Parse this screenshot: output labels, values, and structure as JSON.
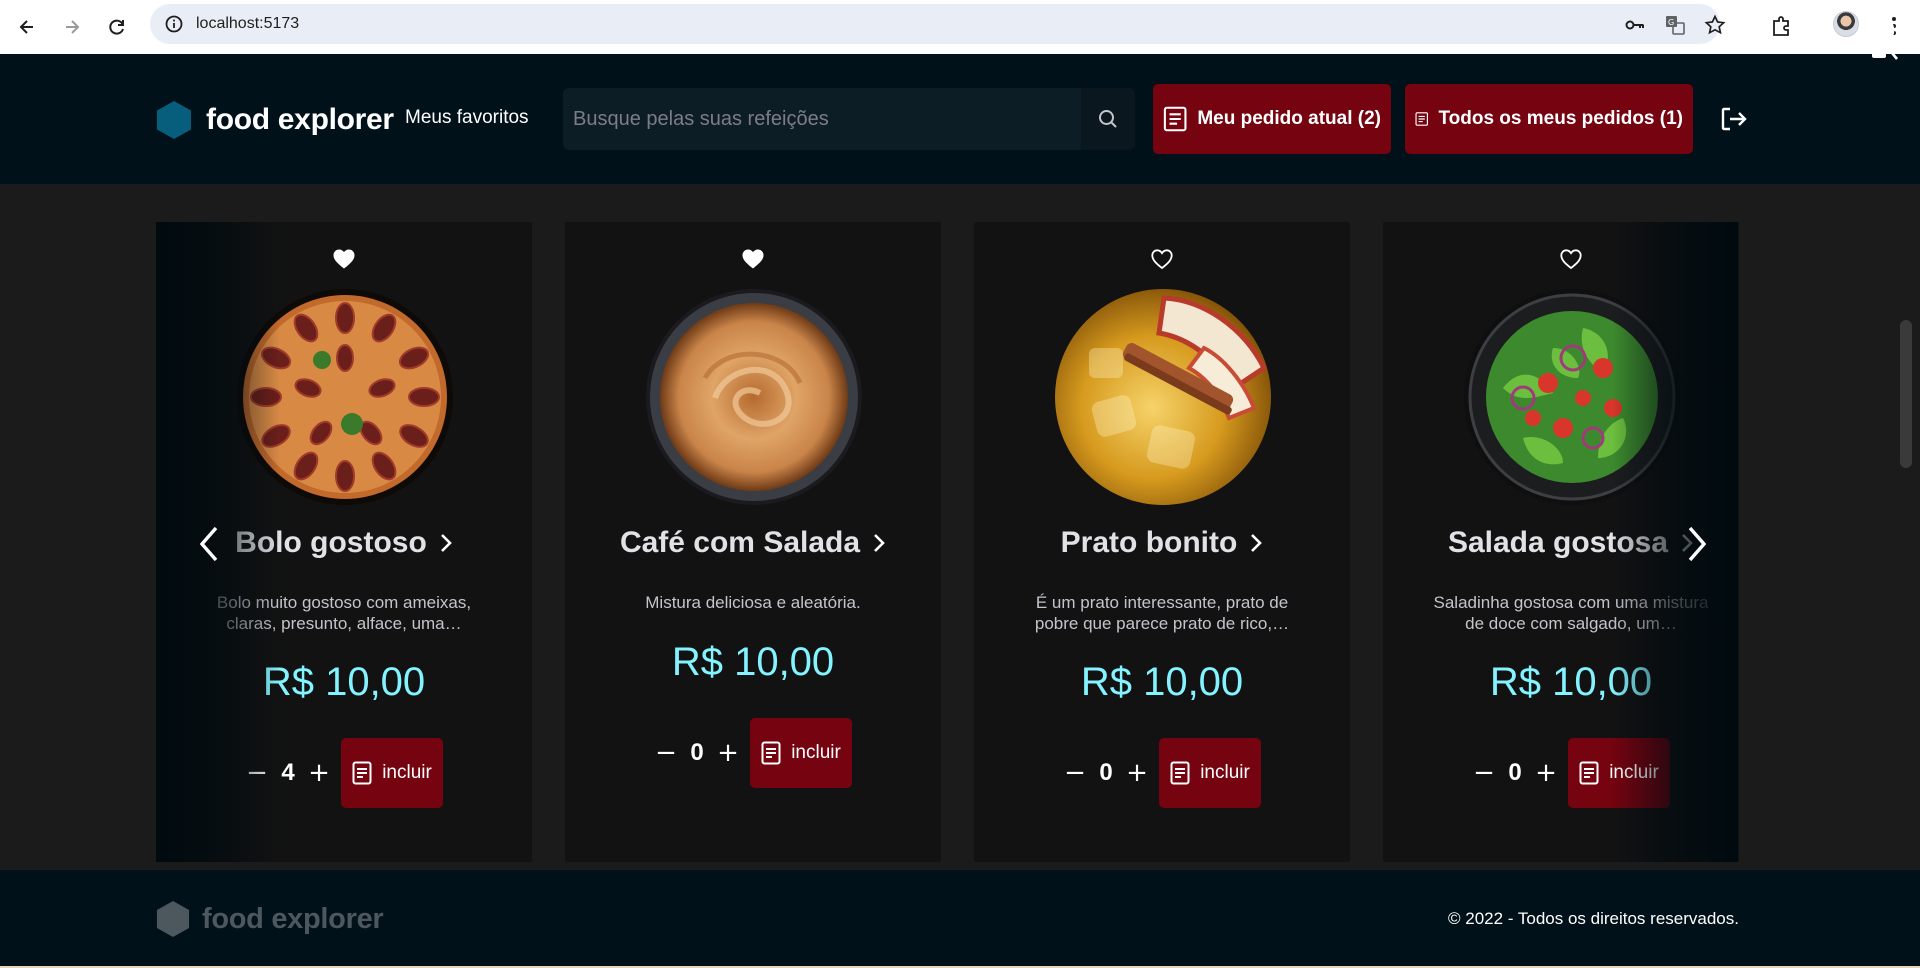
{
  "browser": {
    "url": "localhost:5173"
  },
  "header": {
    "brand": "food explorer",
    "favorites_label": "Meus favoritos",
    "search_placeholder": "Busque pelas suas refeições",
    "current_order_label": "Meu pedido atual (2)",
    "all_orders_label": "Todos os meus pedidos (1)"
  },
  "dishes": [
    {
      "title": "Bolo gostoso",
      "description": "Bolo muito gostoso com ameixas, claras, presunto, alface, uma…",
      "price": "R$ 10,00",
      "quantity": "4",
      "favorite": true,
      "add_label": "incluir",
      "image": "plum-cake"
    },
    {
      "title": "Café com Salada",
      "description": "Mistura deliciosa e aleatória.",
      "price": "R$ 10,00",
      "quantity": "0",
      "favorite": true,
      "add_label": "incluir",
      "image": "coffee-cup"
    },
    {
      "title": "Prato bonito",
      "description": "É um prato interessante, prato de pobre que parece prato de rico,…",
      "price": "R$ 10,00",
      "quantity": "0",
      "favorite": false,
      "add_label": "incluir",
      "image": "apple-cinnamon-drink"
    },
    {
      "title": "Salada gostosa",
      "description": "Saladinha gostosa com uma mistura de doce com salgado, um…",
      "price": "R$ 10,00",
      "quantity": "0",
      "favorite": false,
      "add_label": "incluir",
      "image": "green-salad"
    }
  ],
  "footer": {
    "brand": "food explorer",
    "copyright": "© 2022 - Todos os direitos reservados."
  },
  "colors": {
    "header_bg": "#00111a",
    "page_bg": "#1b1b1b",
    "card_bg": "#121212",
    "accent_red": "#750310",
    "price_cyan": "#82f3ff",
    "brand_hex": "#065e7c"
  }
}
